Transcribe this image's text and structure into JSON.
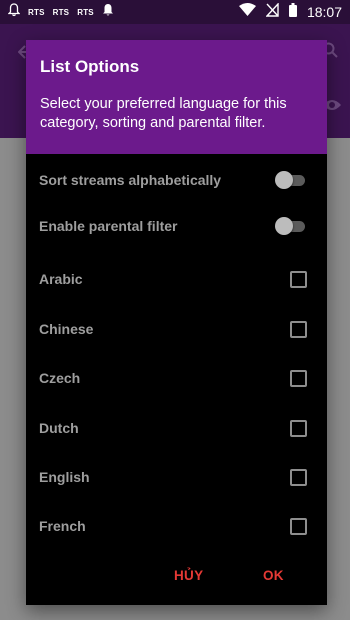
{
  "status_bar": {
    "notifications": [
      "bell-icon",
      "RTS",
      "RTS",
      "RTS",
      "bell-icon"
    ],
    "time": "18:07"
  },
  "dialog": {
    "title": "List Options",
    "message": "Select your preferred language for this category, sorting and parental filter.",
    "toggles": [
      {
        "label": "Sort streams alphabetically",
        "on": false
      },
      {
        "label": "Enable parental filter",
        "on": false
      }
    ],
    "languages": [
      {
        "label": "Arabic",
        "checked": false
      },
      {
        "label": "Chinese",
        "checked": false
      },
      {
        "label": "Czech",
        "checked": false
      },
      {
        "label": "Dutch",
        "checked": false
      },
      {
        "label": "English",
        "checked": false
      },
      {
        "label": "French",
        "checked": false
      }
    ],
    "cancel_label": "HỦY",
    "ok_label": "OK"
  },
  "colors": {
    "header": "#6c1a8c",
    "status_bar": "#2a0f38",
    "dialog_bg": "#000000",
    "action": "#e53935"
  }
}
